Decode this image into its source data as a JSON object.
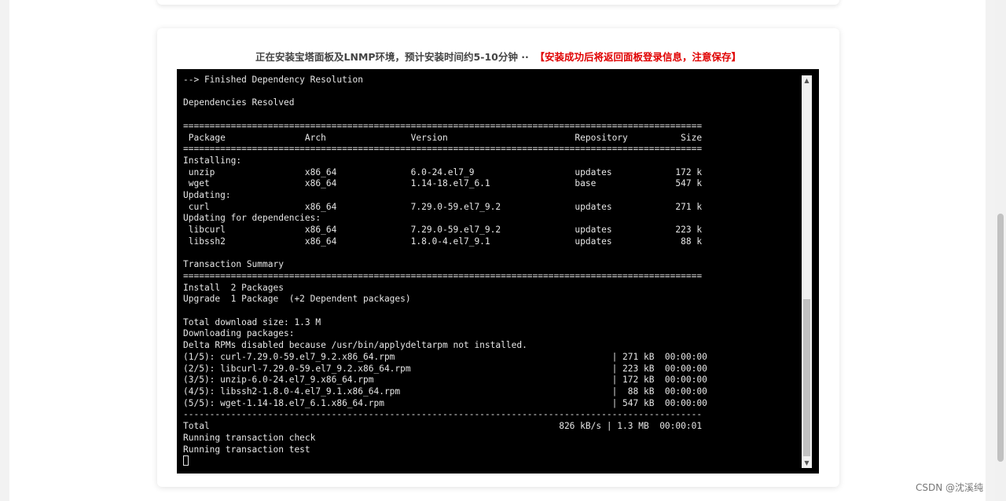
{
  "header": {
    "installing_text": "正在安装宝塔面板及LNMP环境，预计安装时间约5-10分钟 ··",
    "warning_text": "【安装成功后将返回面板登录信息，注意保存】"
  },
  "terminal": {
    "lines": [
      "--> Finished Dependency Resolution",
      "",
      "Dependencies Resolved",
      "",
      "==================================================================================================",
      " Package               Arch                Version                        Repository          Size",
      "==================================================================================================",
      "Installing:",
      " unzip                 x86_64              6.0-24.el7_9                   updates            172 k",
      " wget                  x86_64              1.14-18.el7_6.1                base               547 k",
      "Updating:",
      " curl                  x86_64              7.29.0-59.el7_9.2              updates            271 k",
      "Updating for dependencies:",
      " libcurl               x86_64              7.29.0-59.el7_9.2              updates            223 k",
      " libssh2               x86_64              1.8.0-4.el7_9.1                updates             88 k",
      "",
      "Transaction Summary",
      "==================================================================================================",
      "Install  2 Packages",
      "Upgrade  1 Package  (+2 Dependent packages)",
      "",
      "Total download size: 1.3 M",
      "Downloading packages:",
      "Delta RPMs disabled because /usr/bin/applydeltarpm not installed.",
      "(1/5): curl-7.29.0-59.el7_9.2.x86_64.rpm                                         | 271 kB  00:00:00",
      "(2/5): libcurl-7.29.0-59.el7_9.2.x86_64.rpm                                      | 223 kB  00:00:00",
      "(3/5): unzip-6.0-24.el7_9.x86_64.rpm                                             | 172 kB  00:00:00",
      "(4/5): libssh2-1.8.0-4.el7_9.1.x86_64.rpm                                        |  88 kB  00:00:00",
      "(5/5): wget-1.14-18.el7_6.1.x86_64.rpm                                           | 547 kB  00:00:00",
      "--------------------------------------------------------------------------------------------------",
      "Total                                                                  826 kB/s | 1.3 MB  00:00:01",
      "Running transaction check",
      "Running transaction test"
    ]
  },
  "watermark": "CSDN @沈溪纯"
}
